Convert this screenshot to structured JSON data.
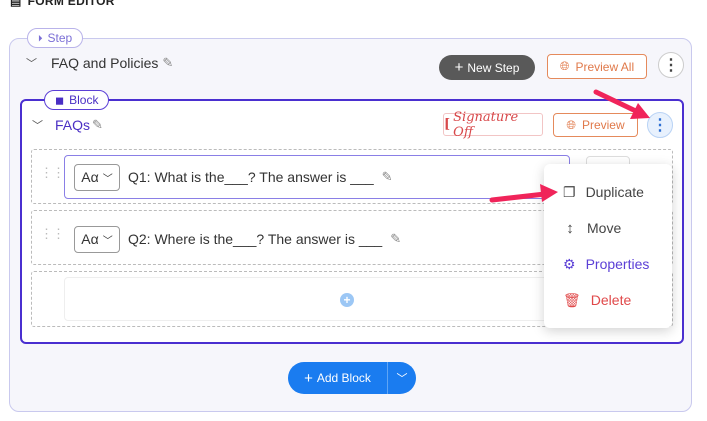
{
  "header": {
    "title": "FORM EDITOR",
    "icon": "document-icon"
  },
  "step": {
    "tag_label": "Step",
    "title": "FAQ and Policies",
    "new_step_label": "New Step",
    "preview_all_label": "Preview All"
  },
  "block": {
    "tag_label": "Block",
    "title": "FAQs",
    "signature_label": "Signature Off",
    "preview_label": "Preview"
  },
  "questions": [
    {
      "type_label": "Aα",
      "text": "Q1: What is the___?  The answer is ___"
    },
    {
      "type_label": "Aα",
      "text": "Q2: Where is the___?  The answer is ___"
    }
  ],
  "menu": {
    "duplicate": "Duplicate",
    "move": "Move",
    "properties": "Properties",
    "delete": "Delete"
  },
  "add_block_label": "Add Block",
  "colors": {
    "accent": "#4a2fd0",
    "primary": "#1a7cf0",
    "preview_orange": "#e0794a",
    "delete_red": "#e0494a",
    "arrow_pink": "#f0245a"
  }
}
